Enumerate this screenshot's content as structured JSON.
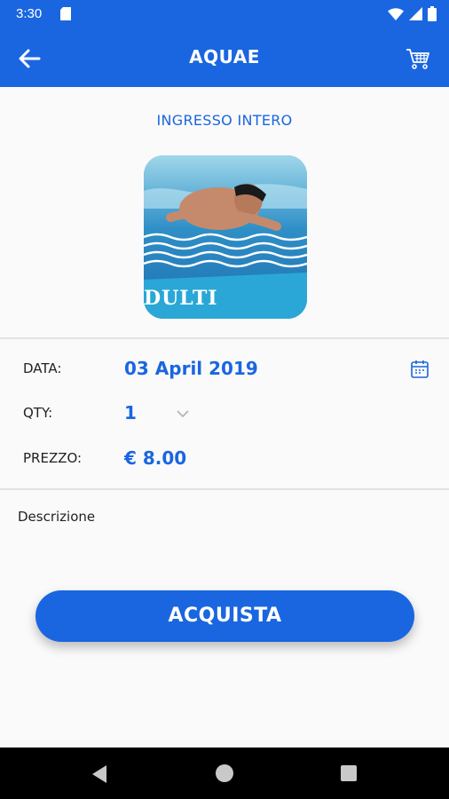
{
  "status_bar": {
    "time": "3:30"
  },
  "app_bar": {
    "title": "AQUAE"
  },
  "product": {
    "title": "INGRESSO INTERO",
    "image_label": "DULTI"
  },
  "details": {
    "date_label": "DATA:",
    "date_value": "03 April 2019",
    "qty_label": "QTY:",
    "qty_value": "1",
    "price_label": "PREZZO:",
    "price_value": "€ 8.00"
  },
  "description": {
    "label": "Descrizione"
  },
  "buy_button": {
    "label": "ACQUISTA"
  },
  "icons": [
    "sim-card-icon",
    "wifi-icon",
    "signal-icon",
    "battery-icon",
    "back-arrow-icon",
    "cart-icon",
    "calendar-icon",
    "chevron-down-icon"
  ],
  "colors": {
    "primary": "#1a66e0",
    "background": "#fafafa",
    "nav_bar": "#000000"
  }
}
